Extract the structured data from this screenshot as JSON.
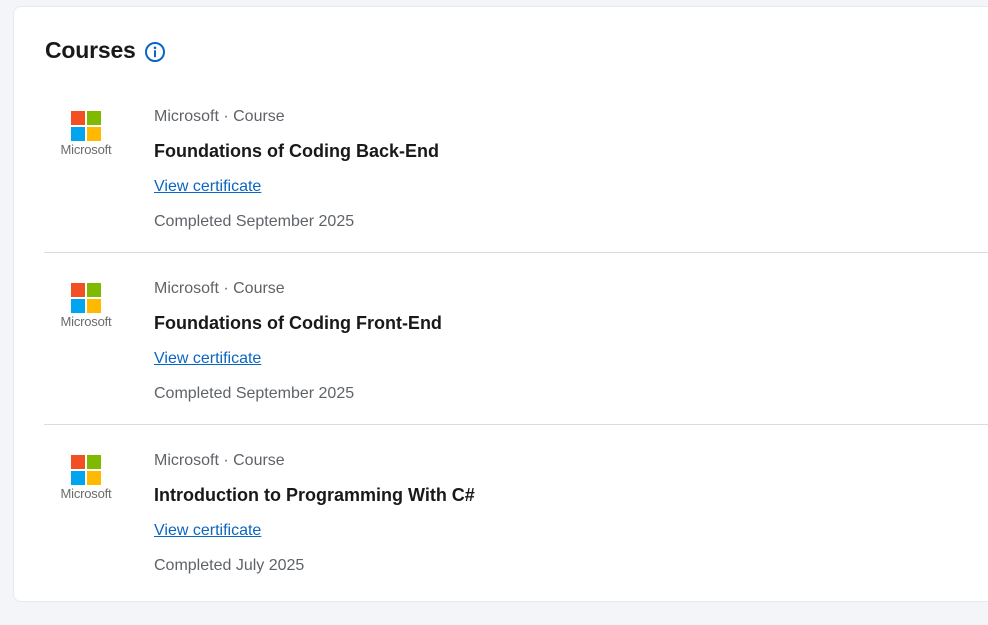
{
  "section": {
    "title": "Courses"
  },
  "colors": {
    "ms_red": "#f25022",
    "ms_green": "#7fba00",
    "ms_blue": "#00a4ef",
    "ms_yellow": "#ffb900",
    "link": "#0a66c2"
  },
  "courses": [
    {
      "logo_text": "Microsoft",
      "meta": "Microsoft · Course",
      "name": "Foundations of Coding Back-End",
      "link_label": "View certificate",
      "completed": "Completed September 2025"
    },
    {
      "logo_text": "Microsoft",
      "meta": "Microsoft · Course",
      "name": "Foundations of Coding Front-End",
      "link_label": "View certificate",
      "completed": "Completed September 2025"
    },
    {
      "logo_text": "Microsoft",
      "meta": "Microsoft · Course",
      "name": "Introduction to Programming With C#",
      "link_label": "View certificate",
      "completed": "Completed July 2025"
    }
  ]
}
